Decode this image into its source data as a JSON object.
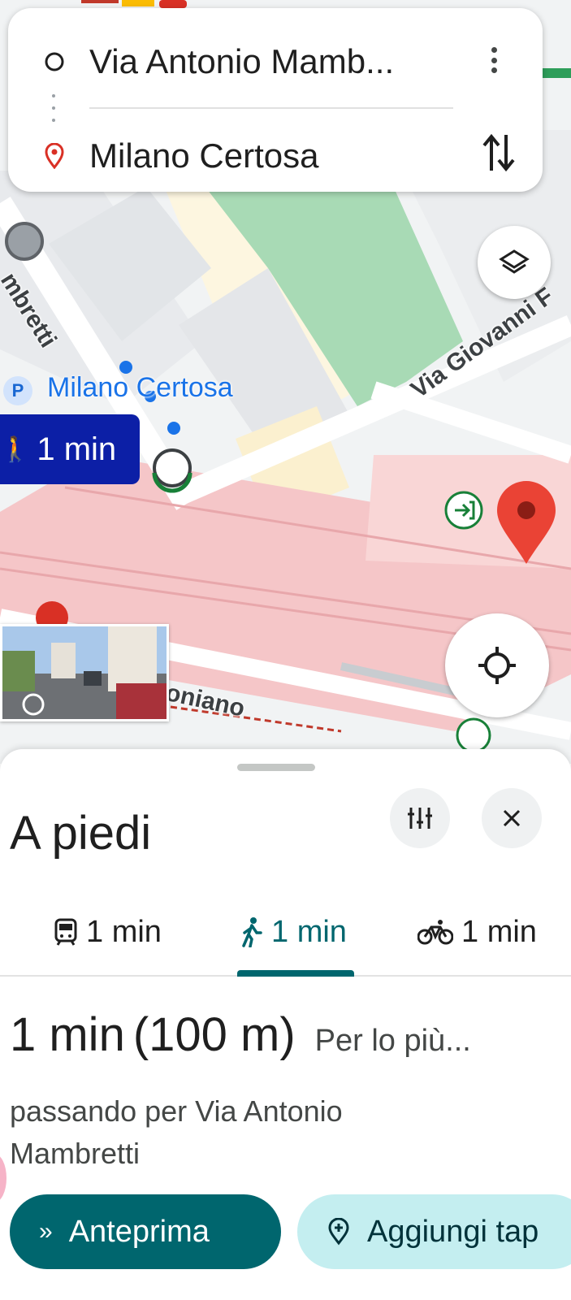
{
  "directions": {
    "origin": "Via Antonio Mamb...",
    "destination": "Milano Certosa",
    "menu_icon": "more-vert-icon",
    "swap_icon": "swap-vert-icon"
  },
  "map": {
    "station_label": "Milano Certosa",
    "parking_badge": "P",
    "street_labels": [
      "mbretti",
      "Via Giovanni F",
      "oniano"
    ],
    "walk_chip": "1 min",
    "colors": {
      "route_blue": "#1a73e8",
      "walk_chip_bg": "#0c1fa6",
      "park_green": "#a8dab5",
      "rail_pink": "#f5c6c8",
      "pin_red": "#ea4335",
      "entrance_green": "#188038"
    }
  },
  "sheet": {
    "title": "A piedi",
    "tabs": [
      {
        "icon": "train-icon",
        "label": "1 min"
      },
      {
        "icon": "walk-icon",
        "label": "1 min",
        "selected": true
      },
      {
        "icon": "bike-icon",
        "label": "1 min"
      }
    ],
    "route": {
      "time": "1 min",
      "distance": "(100 m)",
      "note": "Per lo più...",
      "via": "passando per Via Antonio Mambretti"
    },
    "buttons": {
      "preview": "Anteprima",
      "add_stop": "Aggiungi tap"
    },
    "accent_color": "#00666e"
  }
}
